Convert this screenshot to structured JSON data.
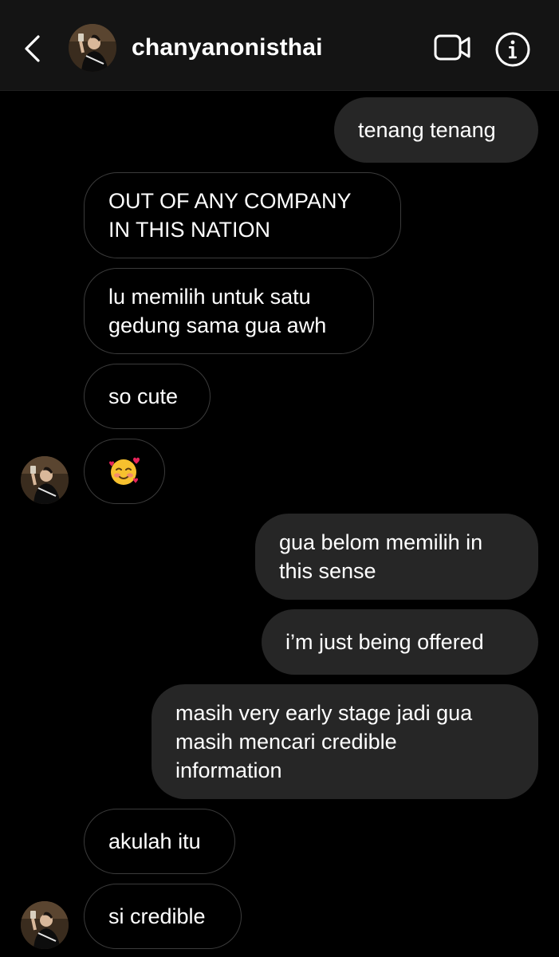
{
  "header": {
    "back_icon": "chevron-left-icon",
    "username": "chanyanonisthai",
    "video_icon": "video-camera-icon",
    "info_icon": "info-icon"
  },
  "messages": [
    {
      "direction": "outgoing",
      "text": "tenang tenang"
    },
    {
      "direction": "incoming",
      "lines": [
        "OUT OF ANY COMPANY",
        "IN THIS NATION"
      ]
    },
    {
      "direction": "incoming",
      "lines": [
        "lu memilih untuk satu",
        "gedung sama gua awh"
      ]
    },
    {
      "direction": "incoming",
      "text": "so cute"
    },
    {
      "direction": "incoming",
      "emoji": "🥰",
      "emoji_name": "smiling-face-with-hearts"
    },
    {
      "direction": "outgoing",
      "lines": [
        "gua belom memilih in",
        "this sense"
      ]
    },
    {
      "direction": "outgoing",
      "text": "i’m just being offered"
    },
    {
      "direction": "outgoing",
      "lines": [
        "masih very early stage jadi gua",
        "masih mencari credible",
        "information"
      ]
    },
    {
      "direction": "incoming",
      "text": "akulah itu"
    },
    {
      "direction": "incoming",
      "text": "si credible"
    }
  ],
  "colors": {
    "background": "#000000",
    "header": "#141414",
    "outgoing_bubble": "#262626",
    "incoming_border": "#3b3b3b",
    "text": "#ffffff"
  }
}
